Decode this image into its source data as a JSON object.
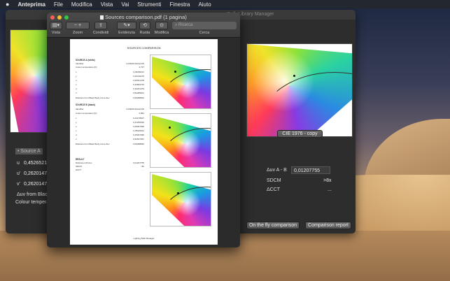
{
  "menubar": {
    "apple": "",
    "items": [
      "Anteprima",
      "File",
      "Modifica",
      "Vista",
      "Vai",
      "Strumenti",
      "Finestra",
      "Aiuto"
    ]
  },
  "bg_window": {
    "title": "Bulb Library Manager",
    "chart_button": "CIE 1976 - copy",
    "source_label": "• Source A",
    "u_label": "u",
    "u_value": "0,4526521",
    "u2_label": "u'",
    "u2_value": "0,2620147",
    "v_label": "v'",
    "v_value": "0,2620147",
    "duv_label": "Δuv from Blac",
    "ct_label": "Colour tempera",
    "delta_uv_label": "Δuv A - B",
    "delta_uv_value": "0,01207755",
    "sdcm_label": "SDCM",
    "sdcm_value": ">8x",
    "dcct_label": "ΔCCT",
    "dcct_value": "...",
    "btn_fly": "On the fly comparison",
    "btn_report": "Comparison report"
  },
  "preview": {
    "title": "Sources comparison.pdf (1 pagina)",
    "toolbar": {
      "vista": "Vista",
      "zoom": "Zoom",
      "condividi": "Condividi",
      "evidenzia": "Evidenzia",
      "ruota": "Ruota",
      "modifica": "Modifica",
      "cerca": "Cerca"
    },
    "search_placeholder": "Ricerca",
    "page": {
      "heading": "SOURCES COMPARISON",
      "sourceA": {
        "title": "SOURCE A (white)",
        "identifier": "Identifier",
        "identifier_value": "LUXEON Rebel ES",
        "ct": "Colour temperature [K]",
        "ct_value": "2,727",
        "rows": [
          [
            "x",
            "0,45265211"
          ],
          [
            "y",
            "0,40130279"
          ],
          [
            "u",
            "0,25031478"
          ],
          [
            "v",
            "0,34842734"
          ],
          [
            "u'",
            "0,26201479"
          ],
          [
            "v'",
            "0,52285601"
          ]
        ],
        "dist": "Distance from Black Body curve Δuv",
        "dist_value": "0,00288664"
      },
      "sourceB": {
        "title": "SOURCE B (black)",
        "identifier": "Identifier",
        "identifier_value": "LUXEON Rebel ES",
        "ct": "Colour temperature [K]",
        "ct_value": "2,862",
        "rows": [
          [
            "x",
            "0,44178637"
          ],
          [
            "y",
            "0,41250549"
          ],
          [
            "u",
            "0,25007390"
          ],
          [
            "v",
            "0,35024911"
          ],
          [
            "u'",
            "0,25007390"
          ],
          [
            "v'",
            "0,52537367"
          ]
        ],
        "dist": "Distance from Black Body curve Δuv",
        "dist_value": "0,00288820"
      },
      "result": {
        "title": "RESULT",
        "rows": [
          [
            "Distance A-B Δuv",
            "0,01207755"
          ],
          [
            "SDCM",
            ">8x"
          ],
          [
            "ΔCCT",
            "..."
          ]
        ]
      },
      "footer": "Lighting Bulb Manager"
    }
  }
}
